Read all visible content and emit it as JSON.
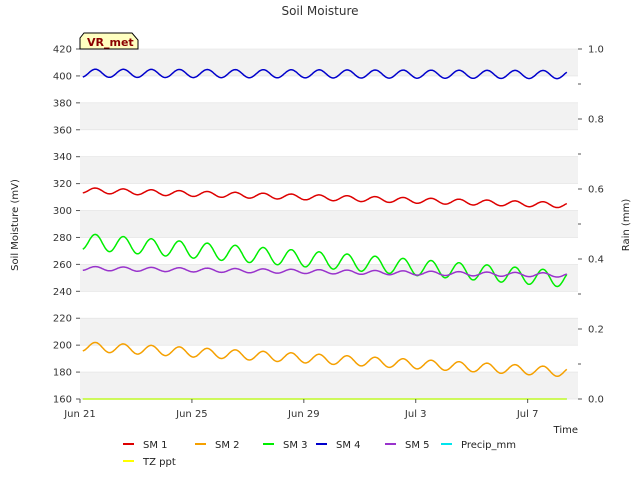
{
  "chart_data": {
    "type": "line",
    "title": "Soil Moisture",
    "xlabel": "Time",
    "ylabel": "Soil Moisture (mV)",
    "y2label": "Rain (mm)",
    "badge": "VR_met",
    "ylim": [
      160,
      420
    ],
    "y_ticks": [
      160,
      180,
      200,
      220,
      240,
      260,
      280,
      300,
      320,
      340,
      360,
      380,
      400,
      420
    ],
    "y2lim": [
      0.0,
      1.0
    ],
    "y2_ticks": [
      "0.0",
      "0.2",
      "0.4",
      "0.6",
      "0.8",
      "1.0"
    ],
    "x_tick_labels": [
      "Jun 21",
      "Jun 25",
      "Jun 29",
      "Jul 3",
      "Jul 7"
    ],
    "x_range_days": [
      0,
      17.8
    ],
    "x_tick_days": [
      0,
      4,
      8,
      12,
      16
    ],
    "grid": "horizontal bands",
    "legend_position": "bottom",
    "series": [
      {
        "name": "SM 1",
        "color": "#dd0000",
        "start": 315,
        "end": 304,
        "amp": 2.0
      },
      {
        "name": "SM 2",
        "color": "#f5a000",
        "start": 199,
        "end": 180,
        "amp": 3.5
      },
      {
        "name": "SM 3",
        "color": "#00ee00",
        "start": 277,
        "end": 249,
        "amp": 6.0
      },
      {
        "name": "SM 4",
        "color": "#0000cc",
        "start": 402,
        "end": 401,
        "amp": 3.0
      },
      {
        "name": "SM 5",
        "color": "#9933cc",
        "start": 257,
        "end": 252,
        "amp": 1.5
      },
      {
        "name": "Precip_mm",
        "color": "#00e5ee",
        "start": 0,
        "end": 0,
        "amp": 0
      },
      {
        "name": "TZ ppt",
        "color": "#ffff00",
        "start": 160,
        "end": 160,
        "amp": 0
      }
    ]
  }
}
